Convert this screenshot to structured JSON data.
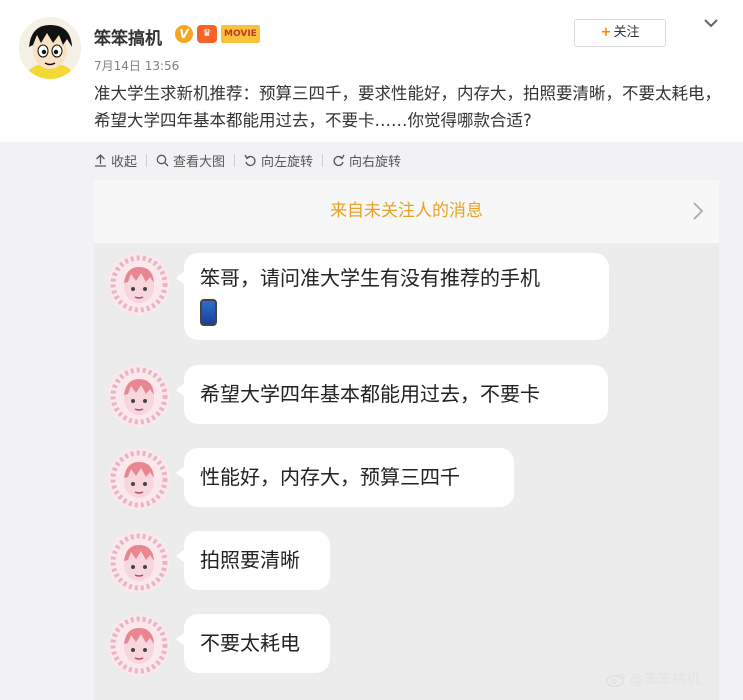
{
  "post": {
    "username": "笨笨搞机",
    "badge_v": "V",
    "badge_crown": "♛",
    "badge_movie": "MOVIE",
    "timestamp": "7月14日 13:56",
    "follow_label": "关注",
    "follow_plus": "+",
    "text": "准大学生求新机推荐：预算三四千，要求性能好，内存大，拍照要清晰，不要太耗电，希望大学四年基本都能用过去，不要卡……你觉得哪款合适?"
  },
  "toolbar": {
    "collapse": "收起",
    "view_large": "查看大图",
    "rotate_left": "向左旋转",
    "rotate_right": "向右旋转"
  },
  "chat": {
    "title": "来自未关注人的消息",
    "messages": [
      {
        "line1": "笨哥，请问准大学生有没有推荐的手机",
        "emoji": "phone"
      },
      {
        "line1": "希望大学四年基本都能用过去，不要卡"
      },
      {
        "line1": "性能好，内存大，预算三四千"
      },
      {
        "line1": "拍照要清晰"
      },
      {
        "line1": "不要太耗电"
      }
    ]
  },
  "watermark": "@笨笨搞机",
  "colors": {
    "accent": "#ff8200",
    "chat_title": "#e8a325",
    "panel_bg": "#f2f2f5"
  },
  "icons": [
    "avatar-cartoon",
    "chevron-down-icon",
    "collapse-icon",
    "search-icon",
    "rotate-left-icon",
    "rotate-right-icon",
    "chevron-right-icon",
    "phone-emoji",
    "weibo-icon"
  ]
}
